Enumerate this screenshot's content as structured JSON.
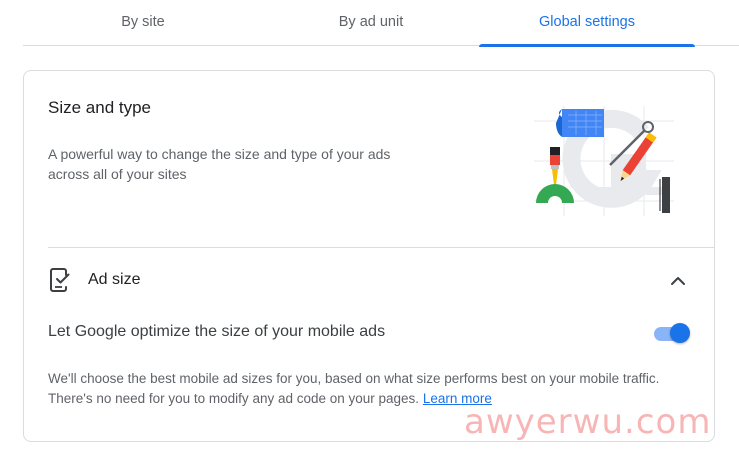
{
  "tabs": [
    {
      "label": "By site",
      "active": false
    },
    {
      "label": "By ad unit",
      "active": false
    },
    {
      "label": "Global settings",
      "active": true
    }
  ],
  "card": {
    "title": "Size and type",
    "description": "A powerful way to change the size and type of your ads across all of your sites",
    "illustration_icon": "design-tools-illustration"
  },
  "ad_size": {
    "title": "Ad size",
    "icon": "mobile-device-check-icon",
    "expanded": true,
    "option": {
      "label": "Let Google optimize the size of your mobile ads",
      "enabled": true
    },
    "description": "We'll choose the best mobile ad sizes for you, based on what size performs best on your mobile traffic. There's no need for you to modify any ad code on your pages.",
    "learn_more": "Learn more"
  },
  "watermark": "awyerwu.com",
  "colors": {
    "accent": "#1a73e8",
    "toggle_track": "#8ab4f8",
    "text_primary": "#202124",
    "text_secondary": "#5f6368",
    "divider": "#dadce0"
  }
}
